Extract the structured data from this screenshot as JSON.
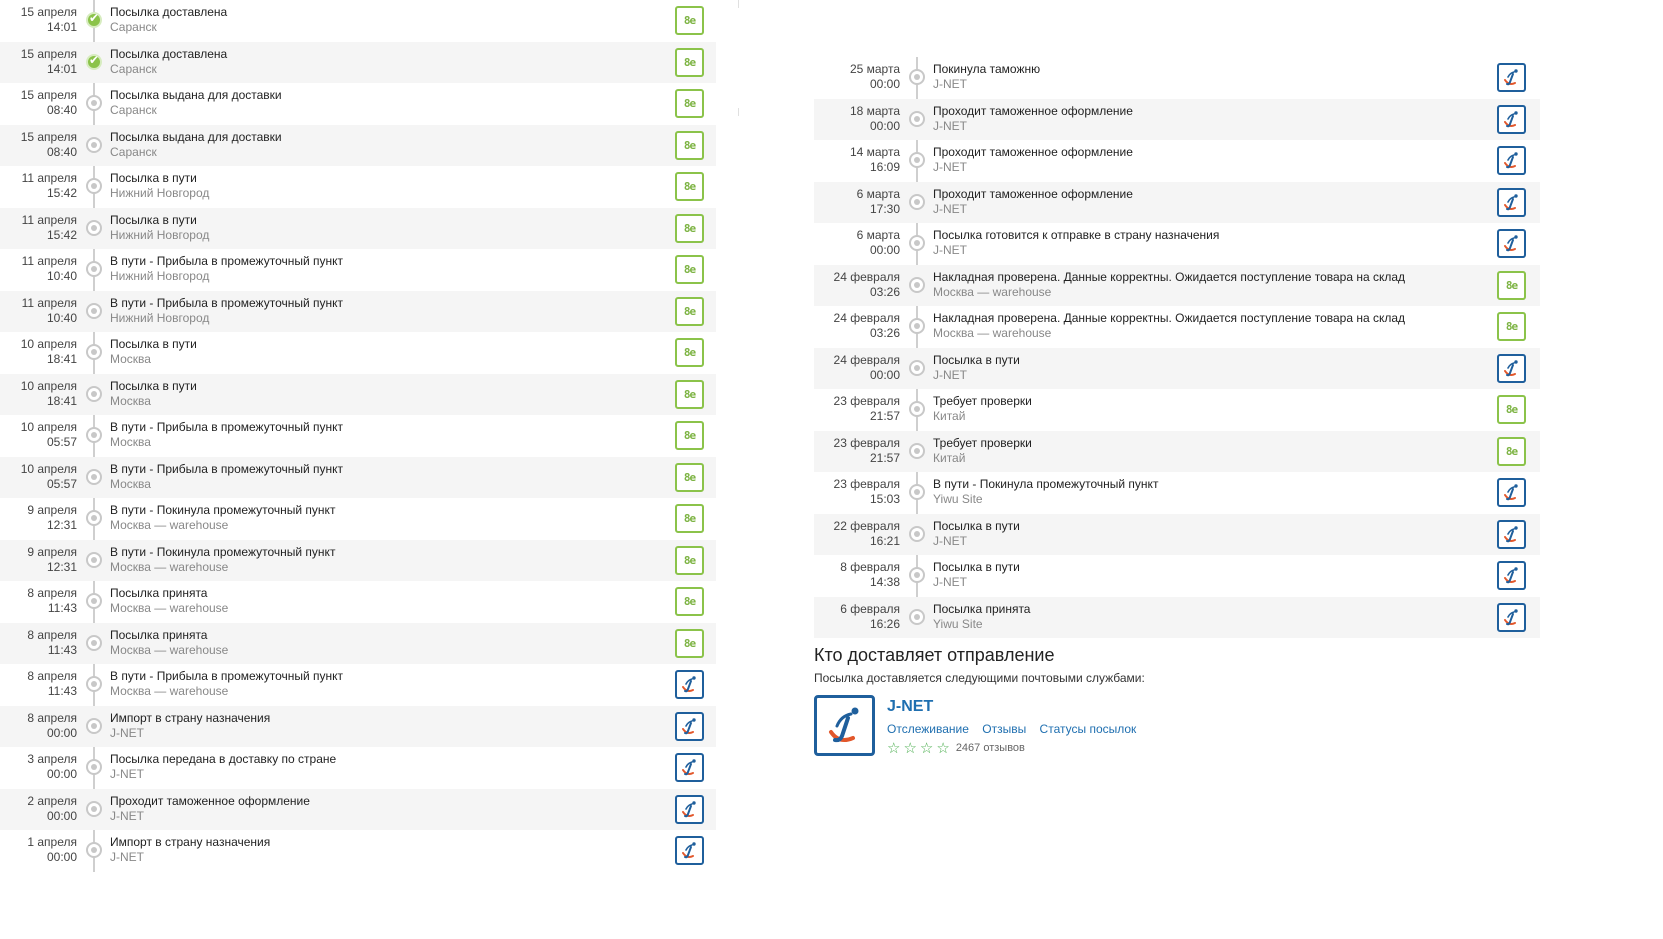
{
  "left_events": [
    {
      "date": "15 апреля",
      "time": "14:01",
      "status": "Посылка доставлена",
      "place": "Саранск",
      "done": true,
      "carrier": "be"
    },
    {
      "date": "15 апреля",
      "time": "14:01",
      "status": "Посылка доставлена",
      "place": "Саранск",
      "done": true,
      "carrier": "be"
    },
    {
      "date": "15 апреля",
      "time": "08:40",
      "status": "Посылка выдана для доставки",
      "place": "Саранск",
      "done": false,
      "carrier": "be"
    },
    {
      "date": "15 апреля",
      "time": "08:40",
      "status": "Посылка выдана для доставки",
      "place": "Саранск",
      "done": false,
      "carrier": "be"
    },
    {
      "date": "11 апреля",
      "time": "15:42",
      "status": "Посылка в пути",
      "place": "Нижний Новгород",
      "done": false,
      "carrier": "be"
    },
    {
      "date": "11 апреля",
      "time": "15:42",
      "status": "Посылка в пути",
      "place": "Нижний Новгород",
      "done": false,
      "carrier": "be"
    },
    {
      "date": "11 апреля",
      "time": "10:40",
      "status": "В пути - Прибыла в промежуточный пункт",
      "place": "Нижний Новгород",
      "done": false,
      "carrier": "be"
    },
    {
      "date": "11 апреля",
      "time": "10:40",
      "status": "В пути - Прибыла в промежуточный пункт",
      "place": "Нижний Новгород",
      "done": false,
      "carrier": "be"
    },
    {
      "date": "10 апреля",
      "time": "18:41",
      "status": "Посылка в пути",
      "place": "Москва",
      "done": false,
      "carrier": "be"
    },
    {
      "date": "10 апреля",
      "time": "18:41",
      "status": "Посылка в пути",
      "place": "Москва",
      "done": false,
      "carrier": "be"
    },
    {
      "date": "10 апреля",
      "time": "05:57",
      "status": "В пути - Прибыла в промежуточный пункт",
      "place": "Москва",
      "done": false,
      "carrier": "be"
    },
    {
      "date": "10 апреля",
      "time": "05:57",
      "status": "В пути - Прибыла в промежуточный пункт",
      "place": "Москва",
      "done": false,
      "carrier": "be"
    },
    {
      "date": "9 апреля",
      "time": "12:31",
      "status": "В пути - Покинула промежуточный пункт",
      "place": "Москва — warehouse",
      "done": false,
      "carrier": "be"
    },
    {
      "date": "9 апреля",
      "time": "12:31",
      "status": "В пути - Покинула промежуточный пункт",
      "place": "Москва — warehouse",
      "done": false,
      "carrier": "be"
    },
    {
      "date": "8 апреля",
      "time": "11:43",
      "status": "Посылка принята",
      "place": "Москва — warehouse",
      "done": false,
      "carrier": "be"
    },
    {
      "date": "8 апреля",
      "time": "11:43",
      "status": "Посылка принята",
      "place": "Москва — warehouse",
      "done": false,
      "carrier": "be"
    },
    {
      "date": "8 апреля",
      "time": "11:43",
      "status": "В пути - Прибыла в промежуточный пункт",
      "place": "Москва — warehouse",
      "done": false,
      "carrier": "jnet"
    },
    {
      "date": "8 апреля",
      "time": "00:00",
      "status": "Импорт в страну назначения",
      "place": "J-NET",
      "done": false,
      "carrier": "jnet"
    },
    {
      "date": "3 апреля",
      "time": "00:00",
      "status": "Посылка передана в доставку по стране",
      "place": "J-NET",
      "done": false,
      "carrier": "jnet"
    },
    {
      "date": "2 апреля",
      "time": "00:00",
      "status": "Проходит таможенное оформление",
      "place": "J-NET",
      "done": false,
      "carrier": "jnet"
    },
    {
      "date": "1 апреля",
      "time": "00:00",
      "status": "Импорт в страну назначения",
      "place": "J-NET",
      "done": false,
      "carrier": "jnet"
    }
  ],
  "right_events": [
    {
      "date": "25 марта",
      "time": "00:00",
      "status": "Покинула таможню",
      "place": "J-NET",
      "done": false,
      "carrier": "jnet"
    },
    {
      "date": "18 марта",
      "time": "00:00",
      "status": "Проходит таможенное оформление",
      "place": "J-NET",
      "done": false,
      "carrier": "jnet"
    },
    {
      "date": "14 марта",
      "time": "16:09",
      "status": "Проходит таможенное оформление",
      "place": "J-NET",
      "done": false,
      "carrier": "jnet"
    },
    {
      "date": "6 марта",
      "time": "17:30",
      "status": "Проходит таможенное оформление",
      "place": "J-NET",
      "done": false,
      "carrier": "jnet"
    },
    {
      "date": "6 марта",
      "time": "00:00",
      "status": "Посылка готовится к отправке в страну назначения",
      "place": "J-NET",
      "done": false,
      "carrier": "jnet"
    },
    {
      "date": "24 февраля",
      "time": "03:26",
      "status": "Накладная проверена. Данные корректны. Ожидается поступление товара на склад",
      "place": "Москва — warehouse",
      "done": false,
      "carrier": "be"
    },
    {
      "date": "24 февраля",
      "time": "03:26",
      "status": "Накладная проверена. Данные корректны. Ожидается поступление товара на склад",
      "place": "Москва — warehouse",
      "done": false,
      "carrier": "be"
    },
    {
      "date": "24 февраля",
      "time": "00:00",
      "status": "Посылка в пути",
      "place": "J-NET",
      "done": false,
      "carrier": "jnet"
    },
    {
      "date": "23 февраля",
      "time": "21:57",
      "status": "Требует проверки",
      "place": "Китай",
      "done": false,
      "carrier": "be"
    },
    {
      "date": "23 февраля",
      "time": "21:57",
      "status": "Требует проверки",
      "place": "Китай",
      "done": false,
      "carrier": "be"
    },
    {
      "date": "23 февраля",
      "time": "15:03",
      "status": "В пути - Покинула промежуточный пункт",
      "place": "Yiwu Site",
      "done": false,
      "carrier": "jnet"
    },
    {
      "date": "22 февраля",
      "time": "16:21",
      "status": "Посылка в пути",
      "place": "J-NET",
      "done": false,
      "carrier": "jnet"
    },
    {
      "date": "8 февраля",
      "time": "14:38",
      "status": "Посылка в пути",
      "place": "J-NET",
      "done": false,
      "carrier": "jnet"
    },
    {
      "date": "6 февраля",
      "time": "16:26",
      "status": "Посылка принята",
      "place": "Yiwu Site",
      "done": false,
      "carrier": "jnet"
    }
  ],
  "logos": {
    "be_text": "8e",
    "be_color": "#8bc34a",
    "jnet_color": "#1f5f9c"
  },
  "carrier_section": {
    "heading": "Кто доставляет отправление",
    "subtitle": "Посылка доставляется следующими почтовыми службами:",
    "name": "J-NET",
    "links": [
      "Отслеживание",
      "Отзывы",
      "Статусы посылок"
    ],
    "stars": 4,
    "reviews": "2467 отзывов"
  }
}
